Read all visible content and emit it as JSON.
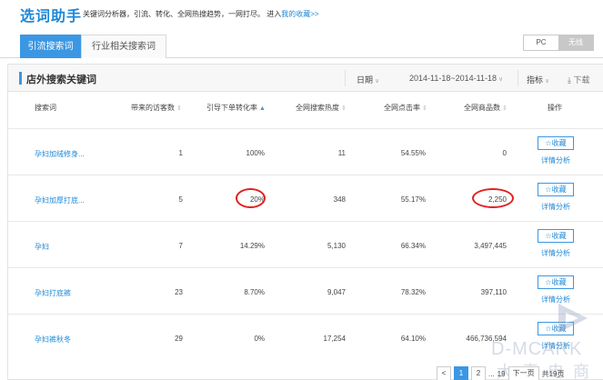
{
  "header": {
    "title": "选词助手",
    "description": "关键词分析器，引流、转化、全网热搜趋势，一网打尽。 进入",
    "favorites_link": "我的收藏>>"
  },
  "tabs": [
    {
      "label": "引流搜索词",
      "active": true
    },
    {
      "label": "行业相关搜索词",
      "active": false
    }
  ],
  "device_toggle": {
    "pc": "PC",
    "wireless": "无线",
    "selected": "无线"
  },
  "panel": {
    "title": "店外搜索关键词",
    "date_label": "日期",
    "date_range": "2014-11-18~2014-11-18",
    "metric_label": "指标",
    "download_label": "下载"
  },
  "table": {
    "columns": [
      "搜索词",
      "带来的访客数",
      "引导下单转化率",
      "全网搜索热度",
      "全网点击率",
      "全网商品数",
      "操作"
    ],
    "sorted_column": "引导下单转化率",
    "rows": [
      {
        "keyword": "孕妇加绒修身...",
        "visitors": "1",
        "conversion": "100%",
        "heat": "11",
        "ctr": "54.55%",
        "goods": "0"
      },
      {
        "keyword": "孕妇加厚打底...",
        "visitors": "5",
        "conversion": "20%",
        "heat": "348",
        "ctr": "55.17%",
        "goods": "2,250"
      },
      {
        "keyword": "孕妇",
        "visitors": "7",
        "conversion": "14.29%",
        "heat": "5,130",
        "ctr": "66.34%",
        "goods": "3,497,445"
      },
      {
        "keyword": "孕妇打底裤",
        "visitors": "23",
        "conversion": "8.70%",
        "heat": "9,047",
        "ctr": "78.32%",
        "goods": "397,110"
      },
      {
        "keyword": "孕妇裤秋冬",
        "visitors": "29",
        "conversion": "0%",
        "heat": "17,254",
        "ctr": "64.10%",
        "goods": "466,736,594"
      }
    ],
    "fav_label": "收藏",
    "detail_label": "详情分析"
  },
  "pagination": {
    "prev": "<",
    "pages": [
      "1",
      "2"
    ],
    "current": "1",
    "ellipsis": "...",
    "last": "19",
    "prev_label": "下一页",
    "total": "共19页"
  },
  "watermark": {
    "en": "D-MCARK",
    "cn": "大麦电商"
  },
  "colors": {
    "accent": "#3b97e3",
    "link": "#1e88d8",
    "annotation": "#e02020"
  }
}
